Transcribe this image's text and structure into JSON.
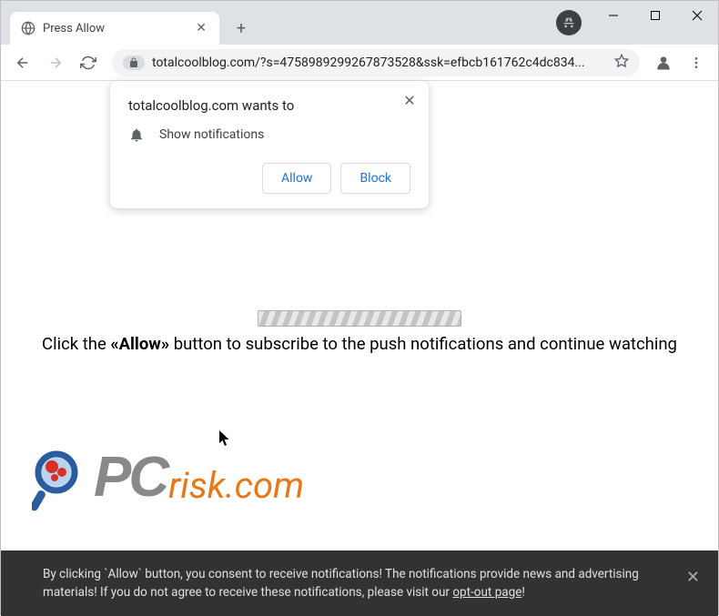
{
  "window": {
    "tab_title": "Press Allow",
    "url": "totalcoolblog.com/?s=4758989299267873528&ssk=efbcb161762c4dc834..."
  },
  "permission": {
    "title": "totalcoolblog.com wants to",
    "item": "Show notifications",
    "allow": "Allow",
    "block": "Block"
  },
  "page": {
    "subscribe_pre": "Click the ",
    "subscribe_bold": "«Allow»",
    "subscribe_post": " button to subscribe to the push notifications and continue watching"
  },
  "logo": {
    "pc": "PC",
    "risk": "risk.com"
  },
  "consent": {
    "line1": "By clicking `Allow` button, you consent to receive notifications! The notifications provide news and advertising",
    "line2a": "materials! If you do not agree to receive these notifications, please visit our ",
    "link": "opt-out page",
    "line2b": "!"
  }
}
